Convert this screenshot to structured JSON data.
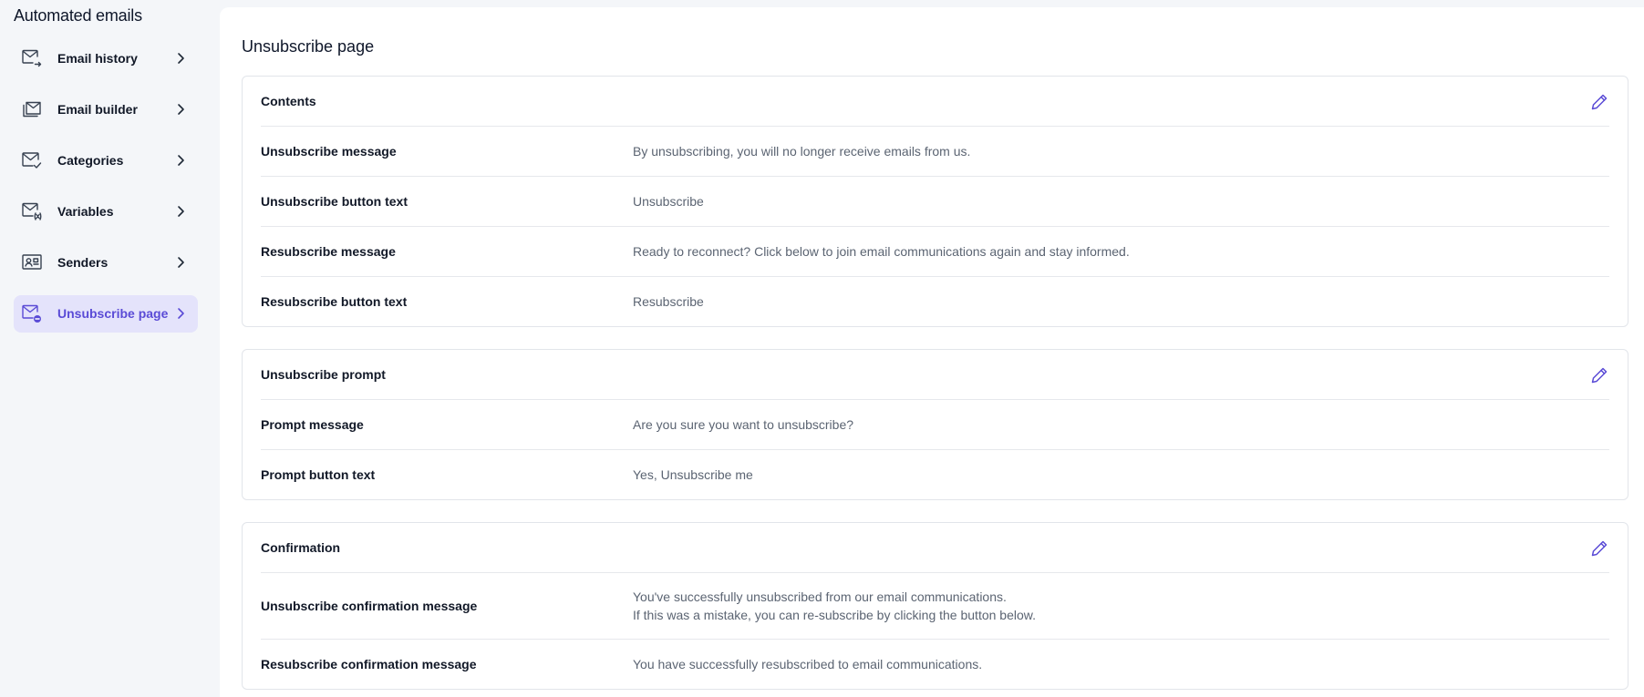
{
  "sidebar": {
    "title": "Automated emails",
    "items": [
      {
        "label": "Email history",
        "icon": "mail-arrow-icon"
      },
      {
        "label": "Email builder",
        "icon": "mail-stack-icon"
      },
      {
        "label": "Categories",
        "icon": "mail-check-icon"
      },
      {
        "label": "Variables",
        "icon": "mail-variable-icon"
      },
      {
        "label": "Senders",
        "icon": "id-card-icon"
      },
      {
        "label": "Unsubscribe page",
        "icon": "mail-unsubscribe-icon",
        "active": true
      }
    ]
  },
  "main": {
    "title": "Unsubscribe page",
    "cards": [
      {
        "title": "Contents",
        "rows": [
          {
            "label": "Unsubscribe message",
            "value": "By unsubscribing, you will no longer receive emails from us."
          },
          {
            "label": "Unsubscribe button text",
            "value": "Unsubscribe"
          },
          {
            "label": "Resubscribe message",
            "value": "Ready to reconnect? Click below to join email communications again and stay informed."
          },
          {
            "label": "Resubscribe button text",
            "value": "Resubscribe"
          }
        ]
      },
      {
        "title": "Unsubscribe prompt",
        "rows": [
          {
            "label": "Prompt message",
            "value": "Are you sure you want to unsubscribe?"
          },
          {
            "label": "Prompt button text",
            "value": "Yes, Unsubscribe me"
          }
        ]
      },
      {
        "title": "Confirmation",
        "rows": [
          {
            "label": "Unsubscribe confirmation message",
            "value": "You've successfully unsubscribed from our email communications.",
            "value2": "If this was a mistake, you can re-subscribe by clicking the button below."
          },
          {
            "label": "Resubscribe confirmation message",
            "value": "You have successfully resubscribed to email communications."
          }
        ]
      }
    ]
  },
  "colors": {
    "accent": "#5a4bd6",
    "active_bg": "#e4e3fb",
    "sidebar_bg": "#f4f6f9",
    "border": "#e2e5ea"
  }
}
